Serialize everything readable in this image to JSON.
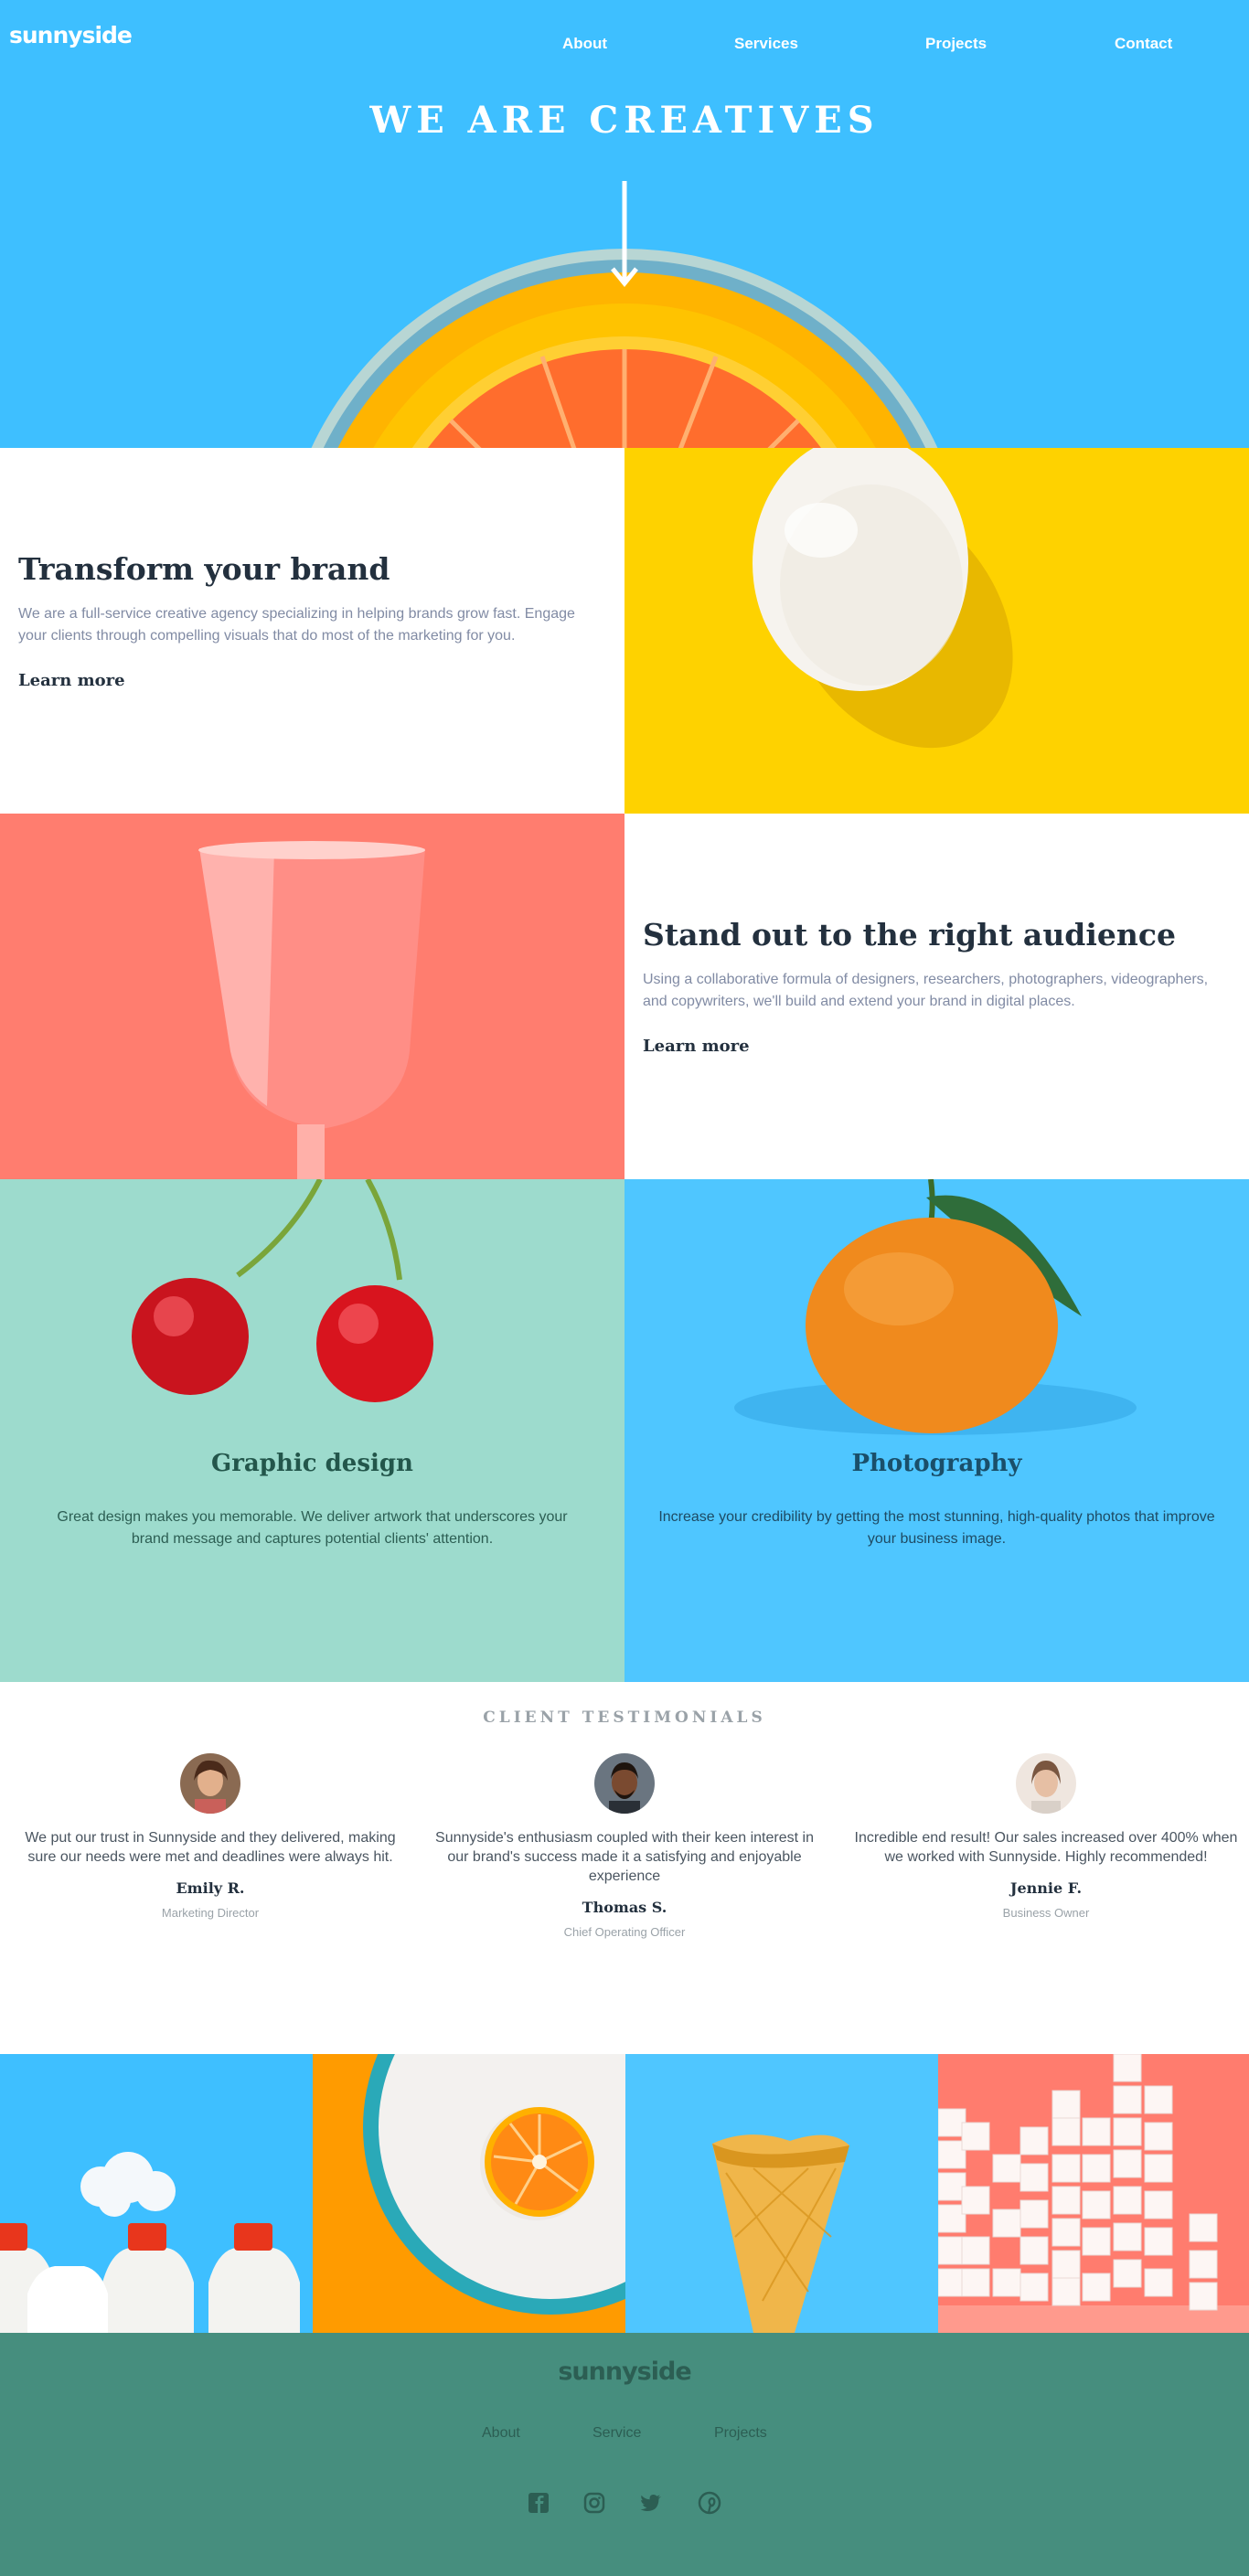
{
  "header": {
    "logo": "sunnyside",
    "nav": [
      "About",
      "Services",
      "Projects",
      "Contact"
    ]
  },
  "hero": {
    "title": "WE ARE CREATIVES",
    "arrow_icon": "arrow-down-icon"
  },
  "features": [
    {
      "title": "Transform your brand",
      "text": "We are a full-service creative agency specializing in helping brands grow fast. Engage your clients through compelling visuals that do most of the marketing for you.",
      "link": "Learn more",
      "underline_color": "#fbd400"
    },
    {
      "title": "Stand out to the right audience",
      "text": "Using a collaborative formula of designers, researchers, photographers, videographers, and copywriters, we'll build and extend your brand in digital places.",
      "link": "Learn more",
      "underline_color": "#ff7b6c"
    }
  ],
  "services": [
    {
      "title": "Graphic design",
      "text": "Great design makes you memorable. We deliver artwork that underscores your brand message and captures potential clients' attention."
    },
    {
      "title": "Photography",
      "text": "Increase your credibility by getting the most stunning, high-quality photos that improve your business image."
    }
  ],
  "testimonials": {
    "heading": "CLIENT TESTIMONIALS",
    "items": [
      {
        "quote": "We put our trust in Sunnyside and they delivered, making sure our needs were met and deadlines were always hit.",
        "name": "Emily R.",
        "role": "Marketing Director"
      },
      {
        "quote": "Sunnyside's enthusiasm coupled with their keen interest in our brand's success made it a satisfying and enjoyable experience",
        "name": "Thomas S.",
        "role": "Chief Operating Officer"
      },
      {
        "quote": "Incredible end result! Our sales increased over 400% when we worked with Sunnyside. Highly recommended!",
        "name": "Jennie F.",
        "role": "Business Owner"
      }
    ]
  },
  "footer": {
    "logo": "sunnyside",
    "links": [
      "About",
      "Service",
      "Projects"
    ],
    "social_icons": [
      "facebook-icon",
      "instagram-icon",
      "twitter-icon",
      "pinterest-icon"
    ]
  },
  "colors": {
    "hero_bg": "#3ebfff",
    "yellow": "#fed200",
    "coral": "#ff7b6c",
    "mint": "#9ddbcd",
    "sky": "#4fc6ff",
    "footer_bg": "#468e7e"
  }
}
